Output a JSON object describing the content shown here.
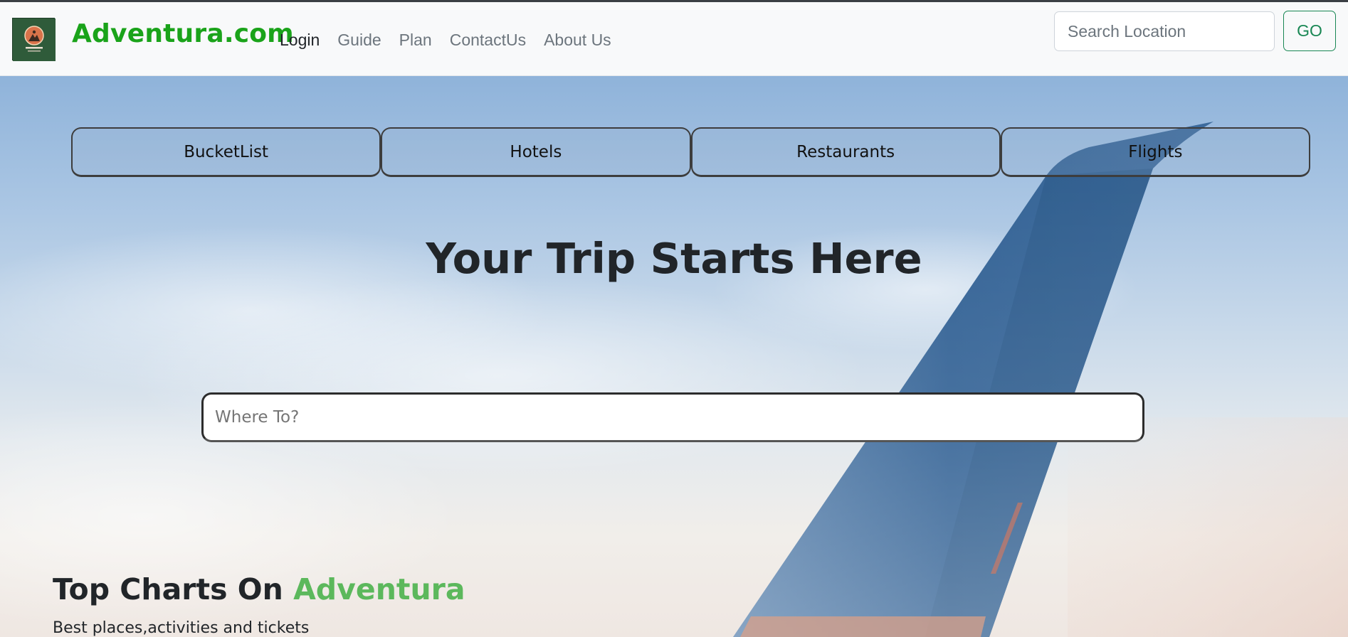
{
  "navbar": {
    "brand": "Adventura.com",
    "links": [
      {
        "label": "Login",
        "active": true
      },
      {
        "label": "Guide",
        "active": false
      },
      {
        "label": "Plan",
        "active": false
      },
      {
        "label": "ContactUs",
        "active": false
      },
      {
        "label": "About Us",
        "active": false
      }
    ],
    "search": {
      "placeholder": "Search Location",
      "value": ""
    },
    "go_label": "GO"
  },
  "hero": {
    "tabs": [
      "BucketList",
      "Hotels",
      "Restaurants",
      "Flights"
    ],
    "title": "Your Trip Starts Here",
    "where_placeholder": "Where To?"
  },
  "top_charts": {
    "heading_prefix": "Top Charts On ",
    "heading_accent": "Adventura",
    "subtitle": "Best places,activities and tickets"
  },
  "colors": {
    "brand": "#1aa31a",
    "accent": "#5cb85c",
    "go_button": "#198754",
    "logo_bg": "#2f5b3a"
  }
}
